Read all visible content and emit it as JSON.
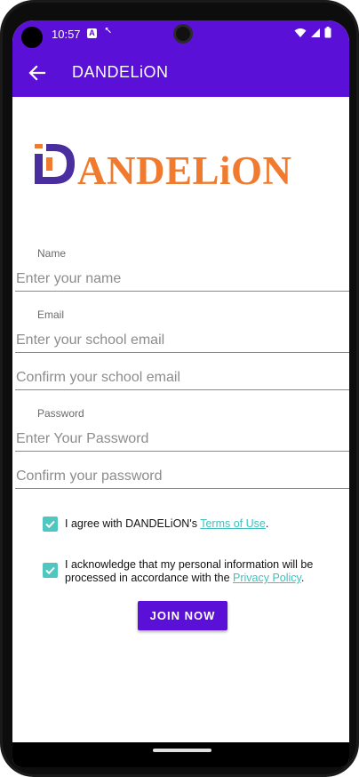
{
  "status_bar": {
    "time": "10:57",
    "notification_badge": "A"
  },
  "app_bar": {
    "title": "DANDELiON"
  },
  "logo": {
    "text": "ANDELiON",
    "mark_color": "#4a2ea0",
    "accent_color": "#f07b2e"
  },
  "form": {
    "name_label": "Name",
    "name_placeholder": "Enter your name",
    "email_label": "Email",
    "email_placeholder": "Enter your school email",
    "confirm_email_placeholder": "Confirm your school email",
    "password_label": "Password",
    "password_placeholder": "Enter Your Password",
    "confirm_password_placeholder": "Confirm your password"
  },
  "terms": {
    "checked": true,
    "prefix": "I agree with DANDELiON's ",
    "link": "Terms of Use",
    "suffix": "."
  },
  "privacy": {
    "checked": true,
    "line1": "I acknowledge that my personal information will be",
    "prefix": "processed in accordance with the ",
    "link": "Privacy Policy",
    "suffix": "."
  },
  "join_button": {
    "label": "JOIN NOW"
  },
  "colors": {
    "primary": "#5a10d6",
    "checkbox": "#4fc7c0",
    "link": "#3ec1bd"
  }
}
